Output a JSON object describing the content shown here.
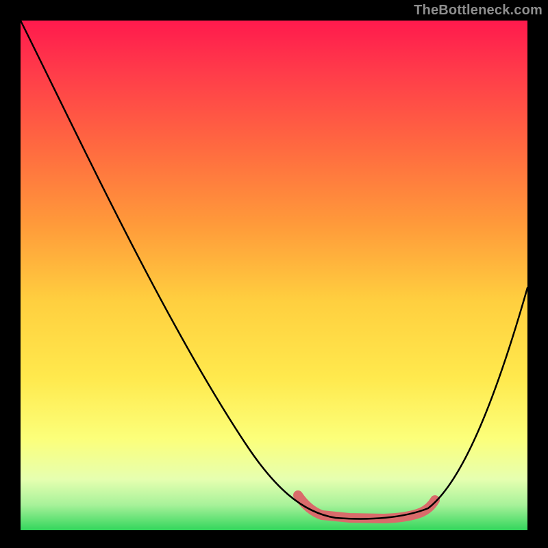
{
  "attribution": "TheBottleneck.com",
  "colors": {
    "black": "#000000",
    "curve": "#000000",
    "highlight": "#d96b6b",
    "grad_top": "#ff1a4d",
    "grad_mid1": "#ff8a33",
    "grad_mid2": "#ffe64d",
    "grad_mid3": "#f6ff99",
    "grad_bottom": "#33d65c"
  },
  "chart_data": {
    "type": "line",
    "title": "",
    "xlabel": "",
    "ylabel": "",
    "x_range": [
      0,
      100
    ],
    "y_range": [
      0,
      100
    ],
    "note": "x is normalized 0–100 across the horizontal gradient box; y is bottleneck magnitude (0 = optimal/minimum, 100 = maximum), plotted with 100 at top.",
    "series": [
      {
        "name": "bottleneck-curve",
        "x": [
          0,
          5,
          10,
          15,
          20,
          25,
          30,
          35,
          40,
          45,
          50,
          55,
          60,
          62,
          65,
          70,
          75,
          80,
          85,
          90,
          95,
          100
        ],
        "y": [
          100,
          92,
          84,
          76,
          68,
          60,
          51,
          42,
          34,
          25,
          16,
          8,
          2,
          0,
          0,
          1,
          2,
          5,
          12,
          22,
          35,
          48
        ]
      }
    ],
    "highlight_region": {
      "name": "optimal-zone",
      "x_start": 55,
      "x_end": 80,
      "description": "flat minimum region marked in salmon"
    }
  }
}
